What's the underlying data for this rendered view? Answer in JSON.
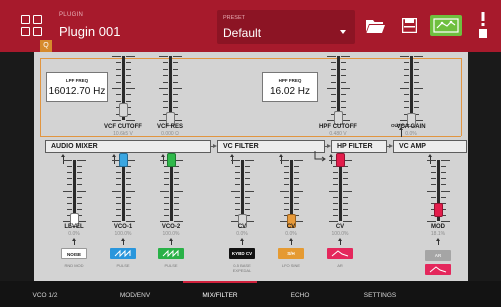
{
  "header": {
    "plugin_caption": "PLUGIN",
    "plugin_name": "Plugin 001",
    "preset_caption": "PRESET",
    "preset_name": "Default"
  },
  "badge": "Q",
  "filter_readouts": {
    "lpf": {
      "caption": "LPF FREQ",
      "value": "16012.70 Hz"
    },
    "hpf": {
      "caption": "HPF FREQ",
      "value": "16.02 Hz"
    }
  },
  "top_sliders": [
    {
      "label": "VCF CUTOFF",
      "value": "10.6k5 V",
      "level": 0.15
    },
    {
      "label": "VCF RES",
      "value": "0.000 Ω",
      "level": 0.02
    },
    {
      "label": "HPF CUTOFF",
      "value": "0.480 V",
      "level": 0.03
    },
    {
      "label": "VCA GAIN",
      "value": "0.0%",
      "level": 0.0
    }
  ],
  "output_label": "OUTPUT",
  "sections": {
    "audio_mixer": "AUDIO MIXER",
    "vc_filter": "VC FILTER",
    "hp_filter": "HP FILTER",
    "vc_amp": "VC AMP"
  },
  "bottom_sliders": [
    {
      "label": "LEVEL",
      "value": "0.0%",
      "color": "#ffffff",
      "level": 0.02,
      "button": "NOISE",
      "button_style": "white",
      "sub": "RND MOD"
    },
    {
      "label": "VCO-1",
      "value": "100.0%",
      "color": "#3aa6e1",
      "level": 1.0,
      "button": "saw-wave-icon",
      "button_style": "blue",
      "sub": "PULSE"
    },
    {
      "label": "VCO-2",
      "value": "100.0%",
      "color": "#2fb84a",
      "level": 1.0,
      "button": "saw-wave-icon",
      "button_style": "green",
      "sub": "PULSE"
    },
    {
      "label": "CV",
      "value": "0.0%",
      "color": "#d8d8d8",
      "level": 0.0,
      "button": "KYBD CV",
      "button_style": "black",
      "sub": "0-5 BASE EXPEDAL"
    },
    {
      "label": "CV",
      "value": "0.0%",
      "color": "#e79a3a",
      "level": 0.0,
      "button": "S/H",
      "button_style": "orange",
      "sub": "LFO SINE"
    },
    {
      "label": "CV",
      "value": "100.0%",
      "color": "#e31c4b",
      "level": 1.0,
      "button": "env-icon",
      "button_style": "red",
      "sub": "AR"
    },
    {
      "label": "MOD",
      "value": "18.1%",
      "color": "#e31c4b",
      "level": 0.18,
      "button": "AR",
      "button_style": "gray",
      "sub": ""
    }
  ],
  "tabs": [
    {
      "label": "VCO 1/2",
      "active": false
    },
    {
      "label": "MOD/ENV",
      "active": false
    },
    {
      "label": "MIX/FILTER",
      "active": true
    },
    {
      "label": "ECHO",
      "active": false
    },
    {
      "label": "SETTINGS",
      "active": false
    }
  ],
  "colors": {
    "header": "#a71a2c",
    "accent": "#d0213c",
    "graph_button": "#6fbf3f",
    "panel": "#d3d3d3"
  }
}
